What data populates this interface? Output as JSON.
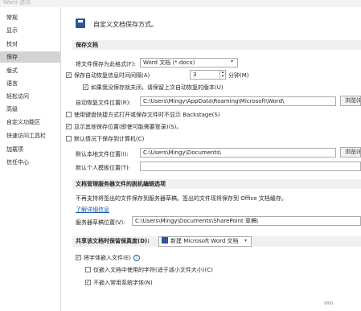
{
  "window": {
    "title": "Word 选项"
  },
  "sidebar": {
    "items": [
      {
        "label": "常规"
      },
      {
        "label": "显示"
      },
      {
        "label": "校对"
      },
      {
        "label": "保存",
        "selected": true
      },
      {
        "label": "版式"
      },
      {
        "label": "语言"
      },
      {
        "label": "轻松访问"
      },
      {
        "label": "高级"
      },
      {
        "label": "自定义功能区"
      },
      {
        "label": "快速访问工具栏"
      },
      {
        "label": "加载项"
      },
      {
        "label": "信任中心"
      }
    ]
  },
  "header": {
    "icon": "save-icon",
    "text": "自定义文档保存方式。"
  },
  "save_docs": {
    "title": "保存文档",
    "format_label": "将文件保存为此格式(F):",
    "format_value": "Word 文档 (*.docx)",
    "autorecover_label": "保存自动恢复信息时间间隔(A)",
    "autorecover_checked": true,
    "autorecover_minutes": "3",
    "minutes_label": "分钟(M)",
    "keep_last_label": "如果我没保存就关闭，请保留上次自动恢复的版本(U)",
    "keep_last_checked": true,
    "autorecover_location_label": "自动恢复文件位置(R):",
    "autorecover_location_value": "C:\\Users\\Mingy\\AppData\\Roaming\\Microsoft\\Word\\",
    "browse_label": "浏览(B)...",
    "no_backstage_label": "使用键盘快捷方式打开或保存文件时不显示 Backstage(S)",
    "no_backstage_checked": false,
    "show_more_label": "显示其他保存位置(即使可能需要登录)(S)。",
    "show_more_checked": true,
    "default_computer_label": "默认情况下保存到计算机(C)",
    "default_computer_checked": false,
    "local_location_label": "默认本地文件位置(I):",
    "local_location_value": "C:\\Users\\Mingy\\Documents\\",
    "browse2_label": "浏览(B)...",
    "templates_location_label": "默认个人模板位置(T):",
    "templates_location_value": ""
  },
  "offline": {
    "title": "文档管理服务器文件的脱机编辑选项",
    "desc": "不再支持将签出的文件保存到服务器草稿。签出的文件现将保存到 Office 文档缓存。",
    "learn_more": "了解详细信息",
    "drafts_label": "服务器草稿位置(V):",
    "drafts_value": "C:\\Users\\Mingy\\Documents\\SharePoint 草稿\\"
  },
  "fidelity": {
    "title": "共享该文档时保留保真度(D):",
    "doc_value": "新建 Microsoft Word 文档",
    "embed_fonts_label": "将字体嵌入文件(E)",
    "embed_fonts_checked": true,
    "embed_used_label": "仅嵌入文档中使用的字符(适于减小文件大小)(C)",
    "embed_used_checked": false,
    "no_common_label": "不嵌入常用系统字体(N)",
    "no_common_checked": true
  },
  "watermark": "WIKI"
}
